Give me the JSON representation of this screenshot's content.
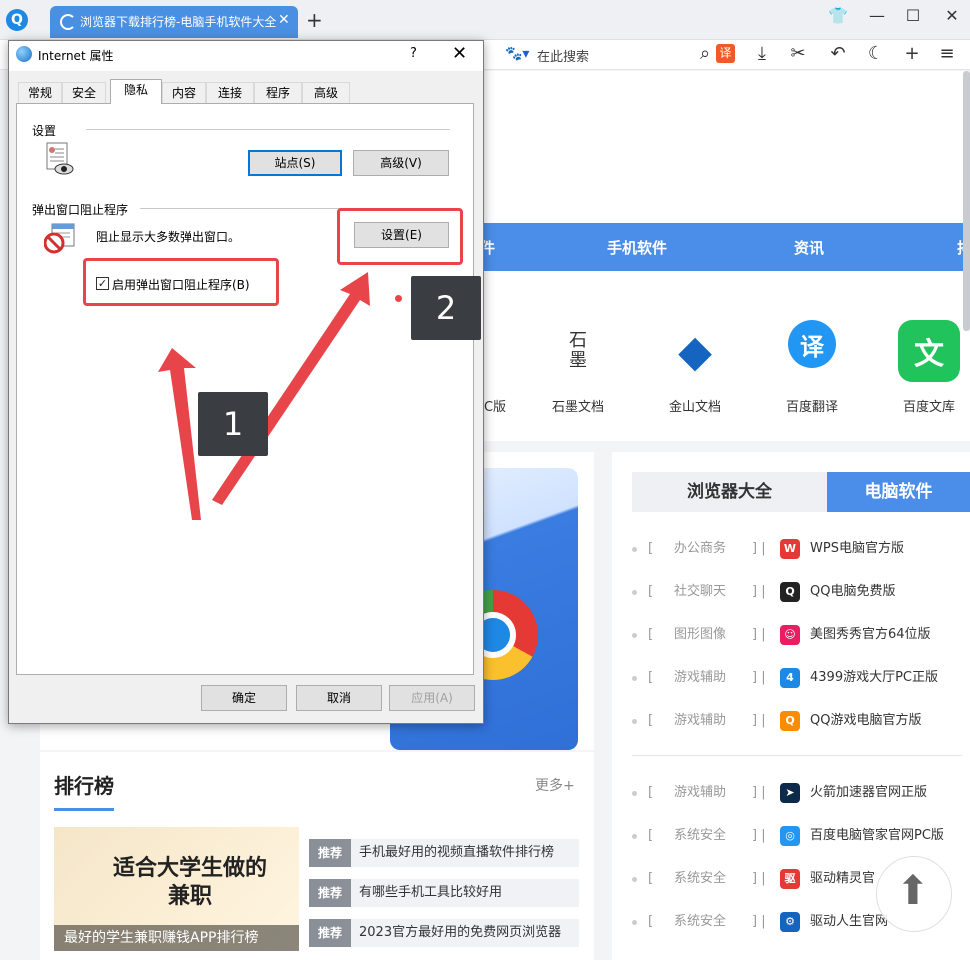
{
  "browser": {
    "logo_letter": "Q",
    "active_tab_title": "浏览器下载排行榜-电脑手机软件大全",
    "search_placeholder": "在此搜索",
    "translate_label": "译"
  },
  "page": {
    "nav": [
      "件",
      "手机软件",
      "资讯",
      "排"
    ],
    "apps": [
      {
        "label": "C版",
        "icon_text": "",
        "color": "#ffffff"
      },
      {
        "label": "石墨文档",
        "icon_text": "石\n墨",
        "color": "#ffffff"
      },
      {
        "label": "金山文档",
        "icon_text": "◆",
        "color": "#1565c0"
      },
      {
        "label": "百度翻译",
        "icon_text": "译",
        "color": "#2196f3"
      },
      {
        "label": "百度文库",
        "icon_text": "文",
        "color": "#21c45c"
      }
    ],
    "ranking": {
      "title": "排行榜",
      "more": "更多+",
      "image_text": "适合大学生做的兼职",
      "image_caption": "最好的学生兼职赚钱APP排行榜",
      "items": [
        {
          "tag": "推荐",
          "text": "手机最好用的视频直播软件排行榜"
        },
        {
          "tag": "推荐",
          "text": "有哪些手机工具比较好用"
        },
        {
          "tag": "推荐",
          "text": "2023官方最好用的免费网页浏览器"
        }
      ]
    },
    "software": {
      "tab_a": "浏览器大全",
      "tab_b": "电脑软件",
      "rows": [
        {
          "category": "办公商务",
          "name": "WPS电脑官方版",
          "icon": "W",
          "color": "#e53935"
        },
        {
          "category": "社交聊天",
          "name": "QQ电脑免费版",
          "icon": "Q",
          "color": "#222222"
        },
        {
          "category": "图形图像",
          "name": "美图秀秀官方64位版",
          "icon": "☺",
          "color": "#e91e63"
        },
        {
          "category": "游戏辅助",
          "name": "4399游戏大厅PC正版",
          "icon": "4",
          "color": "#1e88e5"
        },
        {
          "category": "游戏辅助",
          "name": "QQ游戏电脑官方版",
          "icon": "Q",
          "color": "#fb8c00"
        },
        {
          "category": "游戏辅助",
          "name": "火箭加速器官网正版",
          "icon": "➤",
          "color": "#0d2a4a"
        },
        {
          "category": "系统安全",
          "name": "百度电脑管家官网PC版",
          "icon": "◎",
          "color": "#2196f3"
        },
        {
          "category": "系统安全",
          "name": "驱动精灵官",
          "icon": "驱",
          "color": "#e53935"
        },
        {
          "category": "系统安全",
          "name": "驱动人生官网",
          "icon": "⚙",
          "color": "#1565c0"
        }
      ]
    }
  },
  "dialog": {
    "title": "Internet 属性",
    "help": "?",
    "tabs": [
      "常规",
      "安全",
      "隐私",
      "内容",
      "连接",
      "程序",
      "高级"
    ],
    "settings_group": "设置",
    "sites_button": "站点(S)",
    "advanced_button": "高级(V)",
    "popup_group": "弹出窗口阻止程序",
    "popup_description": "阻止显示大多数弹出窗口。",
    "popup_settings_button": "设置(E)",
    "enable_popup_blocker": "启用弹出窗口阻止程序(B)",
    "ok_button": "确定",
    "cancel_button": "取消",
    "apply_button": "应用(A)"
  },
  "annotations": {
    "badge_1": "1",
    "badge_2": "2",
    "highlight_color": "#e8454b"
  }
}
